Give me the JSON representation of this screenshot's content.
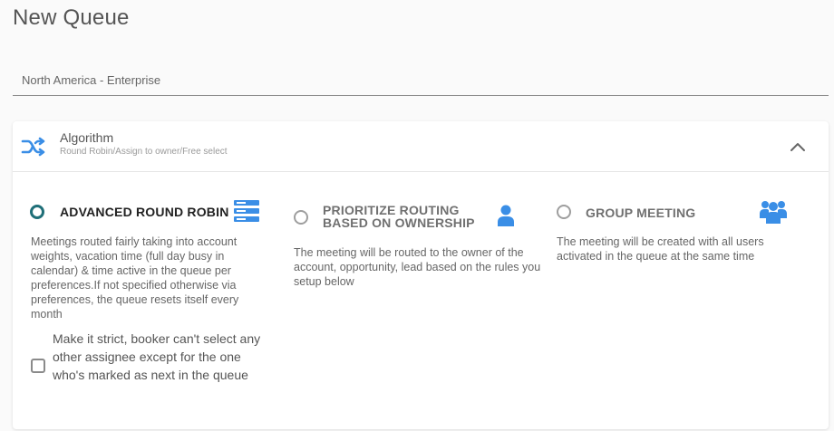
{
  "page": {
    "title": "New Queue"
  },
  "queue_name": {
    "value": "North America - Enterprise"
  },
  "algorithm": {
    "title": "Algorithm",
    "subtitle": "Round Robin/Assign to owner/Free select",
    "expanded": true,
    "header_icon": "shuffle-icon",
    "collapse_icon": "chevron-up-icon",
    "accent_color": "#3a8ee6",
    "options": [
      {
        "label": "ADVANCED ROUND ROBIN",
        "selected": true,
        "icon": "list-icon",
        "description": "Meetings routed fairly taking into account weights, vacation time (full day busy in calendar) & time active in the queue per preferences.If not specified otherwise via preferences, the queue resets itself every month"
      },
      {
        "label_line1": "PRIORITIZE ROUTING",
        "label_line2": "BASED ON OWNERSHIP",
        "selected": false,
        "icon": "user-icon",
        "description": "The meeting will be routed to the owner of the account, opportunity, lead based on the rules you setup below"
      },
      {
        "label": "GROUP MEETING",
        "selected": false,
        "icon": "users-icon",
        "description": "The meeting will be created with all users activated in the queue at the same time"
      }
    ],
    "strict": {
      "checked": false,
      "label": "Make it strict, booker can't select any other assignee except for the one who's marked as next in the queue"
    }
  },
  "colors": {
    "selected_radio": "#1f6f78",
    "icon_blue": "#3a8ee6"
  }
}
